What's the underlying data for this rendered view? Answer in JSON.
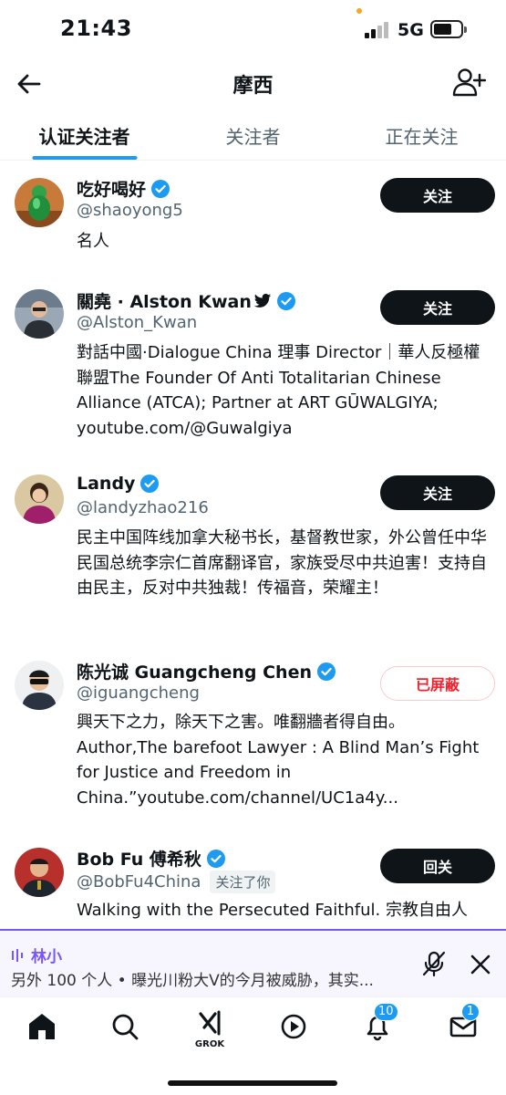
{
  "status_bar": {
    "time": "21:43",
    "network": "5G"
  },
  "header": {
    "title": "摩西"
  },
  "tabs": [
    {
      "label": "认证关注者",
      "active": true
    },
    {
      "label": "关注者",
      "active": false
    },
    {
      "label": "正在关注",
      "active": false
    }
  ],
  "users": [
    {
      "name": "吃好喝好",
      "handle": "@shaoyong5",
      "bio": "名人",
      "button": "关注",
      "verified": true
    },
    {
      "name": "關堯 · Alston Kwan",
      "handle": "@Alston_Kwan",
      "bio": "對話中國·Dialogue China 理事 Director｜華人反極權聯盟The Founder Of Anti Totalitarian Chinese Alliance (ATCA); Partner at ART GŪWALGIYA; youtube.com/@Guwalgiya",
      "button": "关注",
      "verified": true
    },
    {
      "name": "Landy",
      "handle": "@landyzhao216",
      "bio": "民主中国阵线加拿大秘书长，基督教世家，外公曾任中华民国总统李宗仁首席翻译官，家族受尽中共迫害！支持自由民主，反对中共独裁！传福音，荣耀主！",
      "button": "关注",
      "verified": true
    },
    {
      "name": "陈光诚 Guangcheng Chen",
      "handle": "@iguangcheng",
      "bio": "興天下之力，除天下之害。唯翻牆者得自由。Author,The barefoot Lawyer : A Blind Man’s Fight for Justice and Freedom in China.”youtube.com/channel/UC1a4y...",
      "button": "已屏蔽",
      "verified": true
    },
    {
      "name": "Bob Fu 傅希秋",
      "handle": "@BobFu4China",
      "follows_you": "关注了你",
      "bio": "Walking with the Persecuted Faithful. 宗教自由人",
      "button": "回关",
      "verified": true
    }
  ],
  "now_playing": {
    "host": "林小",
    "text": "另外 100 个人 • 曝光川粉大V的今月被威胁，其实..."
  },
  "bottom_nav": {
    "grok_label": "GROK",
    "notifications_badge": "10",
    "messages_badge": "1"
  },
  "colors": {
    "accent": "#1d9bf0",
    "spaces": "#7856ff",
    "blocked": "#f4212e"
  }
}
